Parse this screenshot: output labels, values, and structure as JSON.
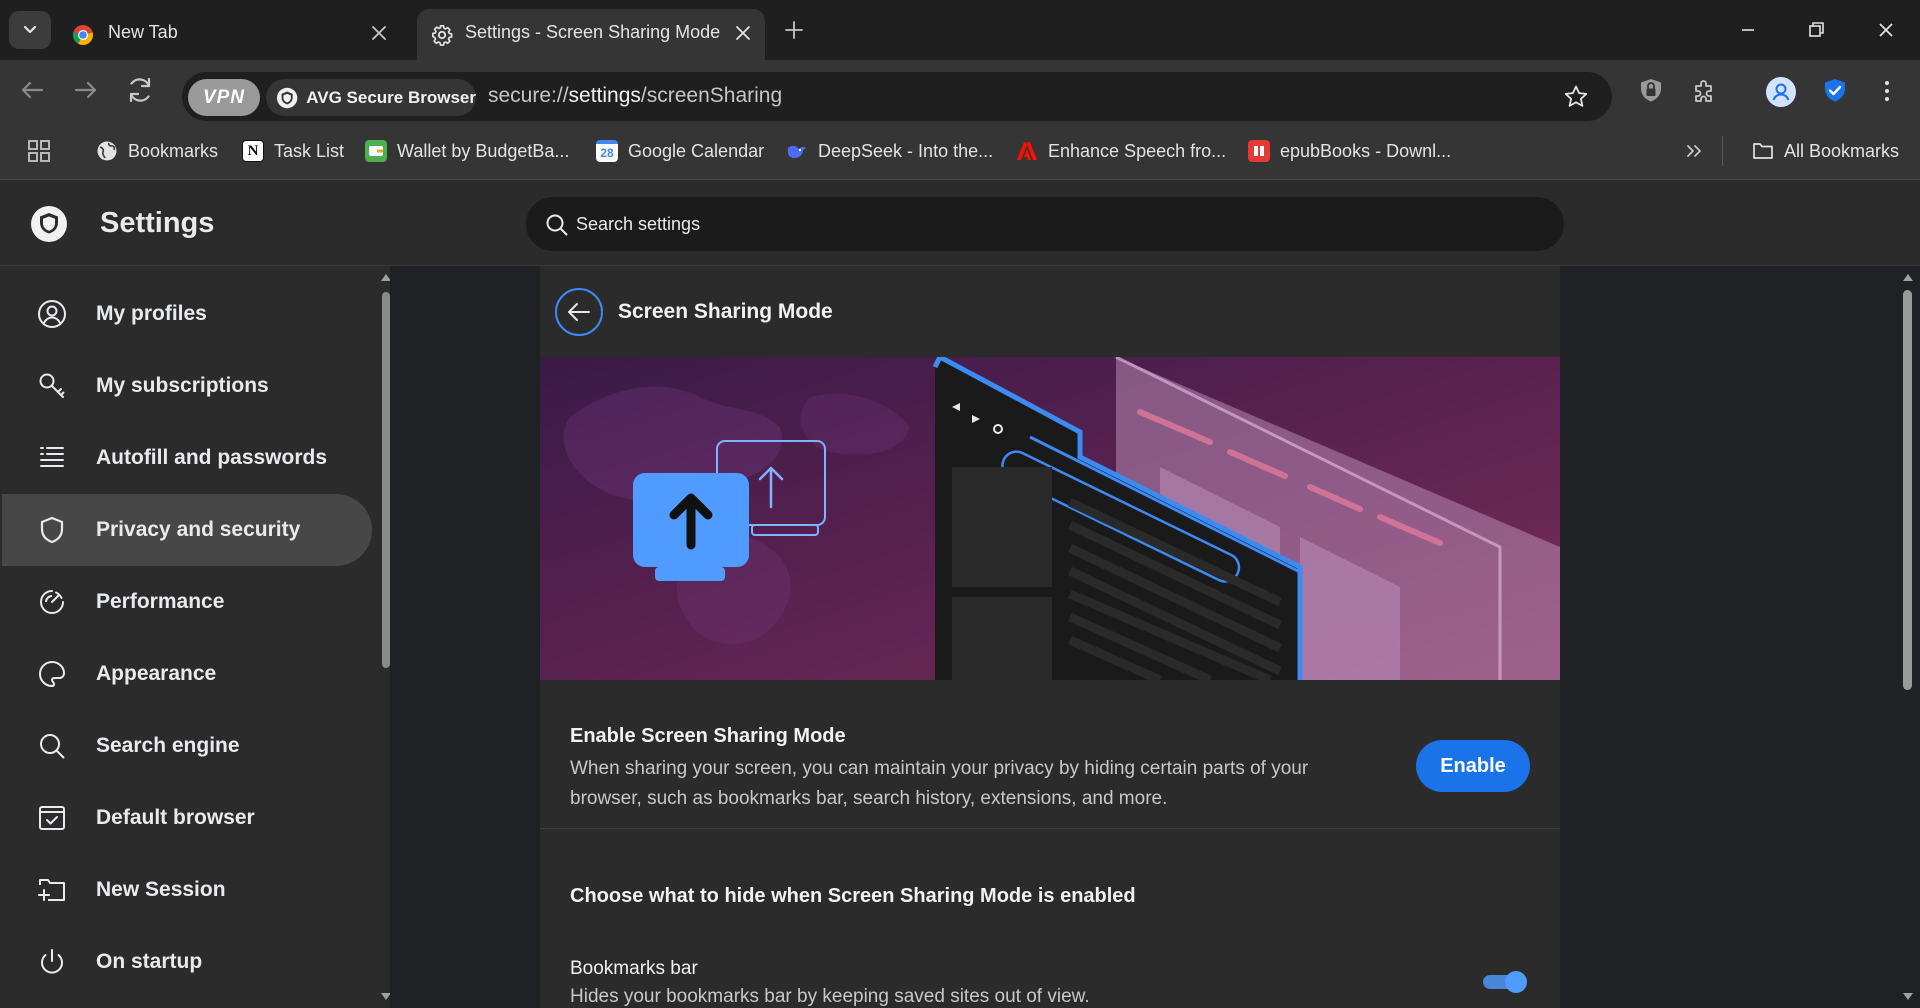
{
  "tabs": [
    {
      "title": "New Tab",
      "active": false
    },
    {
      "title": "Settings - Screen Sharing Mode",
      "active": true
    }
  ],
  "toolbar": {
    "vpn_label": "VPN",
    "secure_browser_label": "AVG Secure Browser",
    "url_scheme": "secure://",
    "url_host": "settings",
    "url_path": "/screenSharing"
  },
  "bookmarks": {
    "items": [
      {
        "label": "Bookmarks",
        "icon": "globe-icon"
      },
      {
        "label": "Task List",
        "icon": "notion-icon"
      },
      {
        "label": "Wallet by BudgetBa...",
        "icon": "wallet-icon"
      },
      {
        "label": "Google Calendar",
        "icon": "calendar-icon"
      },
      {
        "label": "DeepSeek - Into the...",
        "icon": "deepseek-icon"
      },
      {
        "label": "Enhance Speech fro...",
        "icon": "adobe-icon"
      },
      {
        "label": "epubBooks - Downl...",
        "icon": "epubbooks-icon"
      }
    ],
    "all_bookmarks_label": "All Bookmarks"
  },
  "settings": {
    "title": "Settings",
    "search_placeholder": "Search settings"
  },
  "sidebar": {
    "items": [
      {
        "label": "My profiles",
        "icon": "profile-icon",
        "active": false
      },
      {
        "label": "My subscriptions",
        "icon": "key-icon",
        "active": false
      },
      {
        "label": "Autofill and passwords",
        "icon": "list-icon",
        "active": false
      },
      {
        "label": "Privacy and security",
        "icon": "shield-icon",
        "active": true
      },
      {
        "label": "Performance",
        "icon": "speedometer-icon",
        "active": false
      },
      {
        "label": "Appearance",
        "icon": "palette-icon",
        "active": false
      },
      {
        "label": "Search engine",
        "icon": "search-icon",
        "active": false
      },
      {
        "label": "Default browser",
        "icon": "browser-window-icon",
        "active": false
      },
      {
        "label": "New Session",
        "icon": "new-session-icon",
        "active": false
      },
      {
        "label": "On startup",
        "icon": "power-icon",
        "active": false
      }
    ]
  },
  "page": {
    "title": "Screen Sharing Mode",
    "enable_row": {
      "title": "Enable Screen Sharing Mode",
      "description": "When sharing your screen, you can maintain your privacy by hiding certain parts of your browser, such as bookmarks bar, search history, extensions, and more.",
      "button_label": "Enable"
    },
    "section_title": "Choose what to hide when Screen Sharing Mode is enabled",
    "bookmarks_bar_row": {
      "title": "Bookmarks bar",
      "description": "Hides your bookmarks bar by keeping saved sites out of view.",
      "toggle_on": true
    }
  },
  "colors": {
    "accent": "#1a73e8",
    "active_nav": "#474747",
    "banner_purple": "#4a1e4e"
  }
}
